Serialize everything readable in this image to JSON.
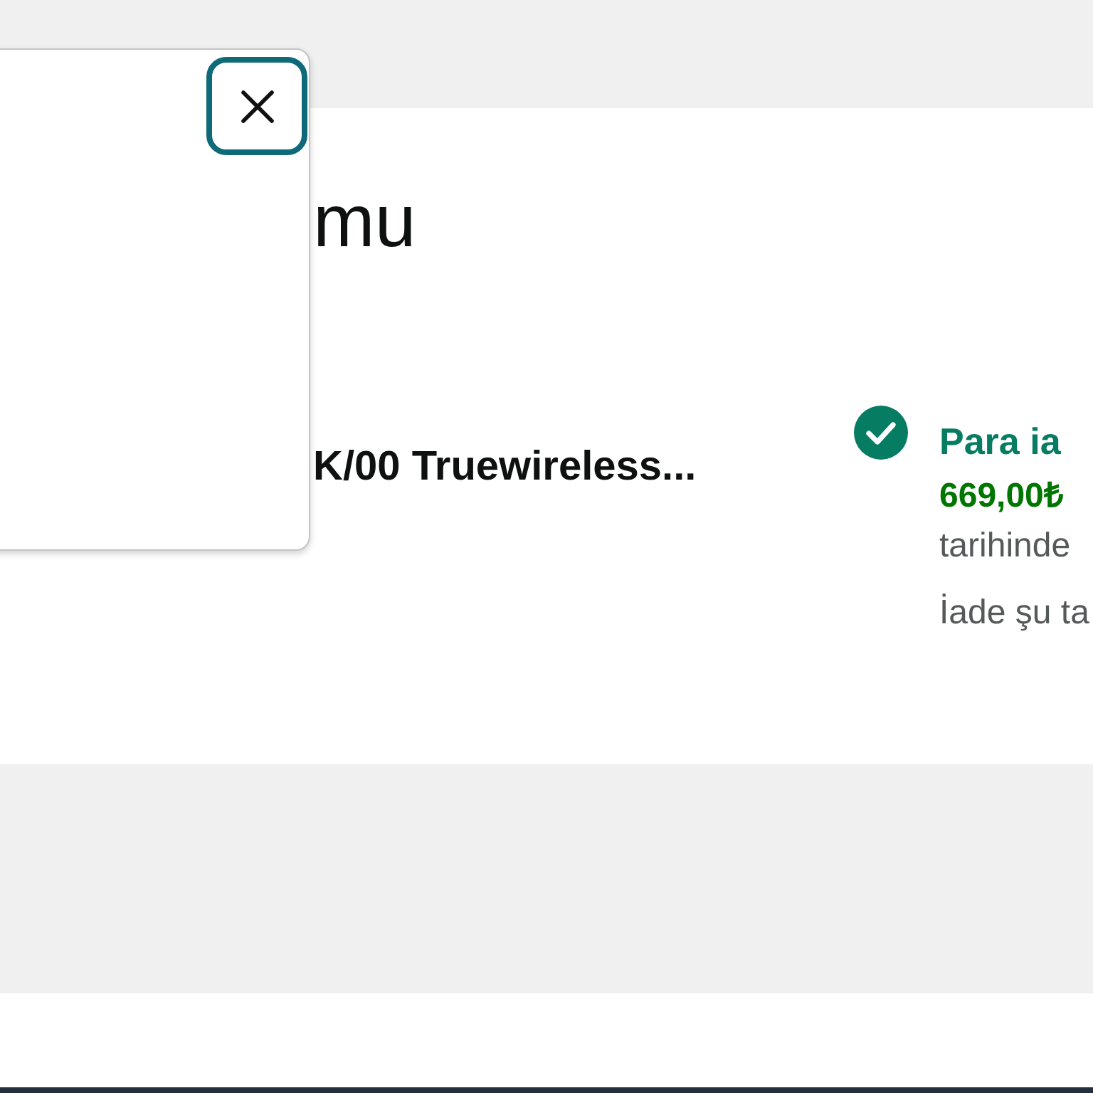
{
  "heading": "mu",
  "order": {
    "product_title": "K/00 Truewireless..."
  },
  "refund_status": {
    "title": "Para ia",
    "amount": "669,00₺",
    "detail": "tarihinde",
    "note": "İade şu ta"
  }
}
